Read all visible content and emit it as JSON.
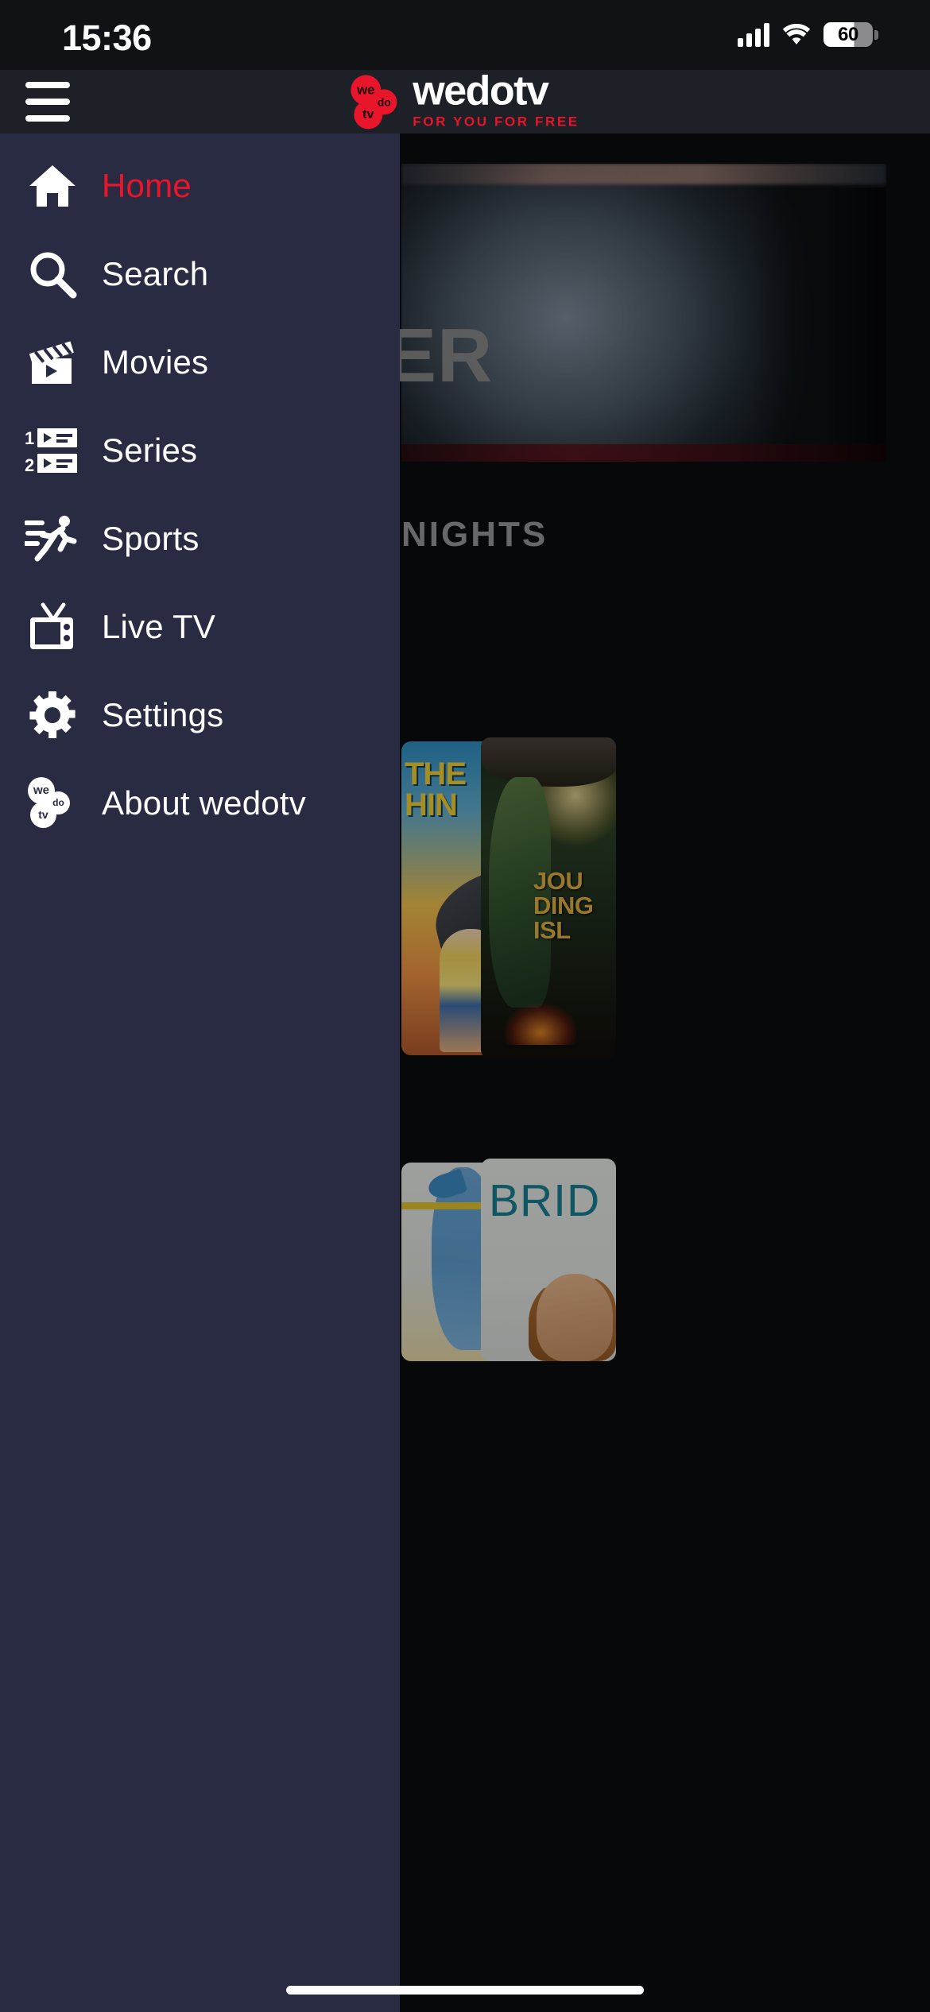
{
  "status_bar": {
    "time": "15:36",
    "battery_percent": "60",
    "signal_icon": "cellular-signal-icon",
    "wifi_icon": "wifi-icon",
    "battery_icon": "battery-icon"
  },
  "header": {
    "menu_icon": "hamburger-menu-icon",
    "logo": {
      "mark_lines": [
        "we",
        "do",
        "tv"
      ],
      "wordmark": "wedotv",
      "tagline": "FOR YOU FOR FREE",
      "brand_red": "#E8152B",
      "wordmark_color": "#FFFFFF"
    }
  },
  "drawer": {
    "background": "#282B42",
    "active_color": "#E8152B",
    "inactive_color": "#FFFFFF",
    "items": [
      {
        "label": "Home",
        "icon": "home-icon",
        "active": true
      },
      {
        "label": "Search",
        "icon": "search-icon",
        "active": false
      },
      {
        "label": "Movies",
        "icon": "clapperboard-icon",
        "active": false
      },
      {
        "label": "Series",
        "icon": "playlist-icon",
        "active": false
      },
      {
        "label": "Sports",
        "icon": "running-icon",
        "active": false
      },
      {
        "label": "Live TV",
        "icon": "television-icon",
        "active": false
      },
      {
        "label": "Settings",
        "icon": "gear-icon",
        "active": false
      },
      {
        "label": "About wedotv",
        "icon": "wedotv-mark-icon",
        "active": false
      }
    ]
  },
  "background_content": {
    "hero_title": "ER",
    "hero_subtitle": "NIGHTS",
    "posters": [
      {
        "name": "dolphin-poster",
        "title_line1": "THE",
        "title_line2": "HIN"
      },
      {
        "name": "dino-poster",
        "title_line1": "JOU",
        "title_line2": "DING",
        "title_line3": "ISL"
      },
      {
        "name": "cartoon-poster",
        "title": ""
      },
      {
        "name": "bridal-poster",
        "title": "BRID"
      }
    ]
  },
  "system": {
    "home_indicator": "home-indicator"
  }
}
